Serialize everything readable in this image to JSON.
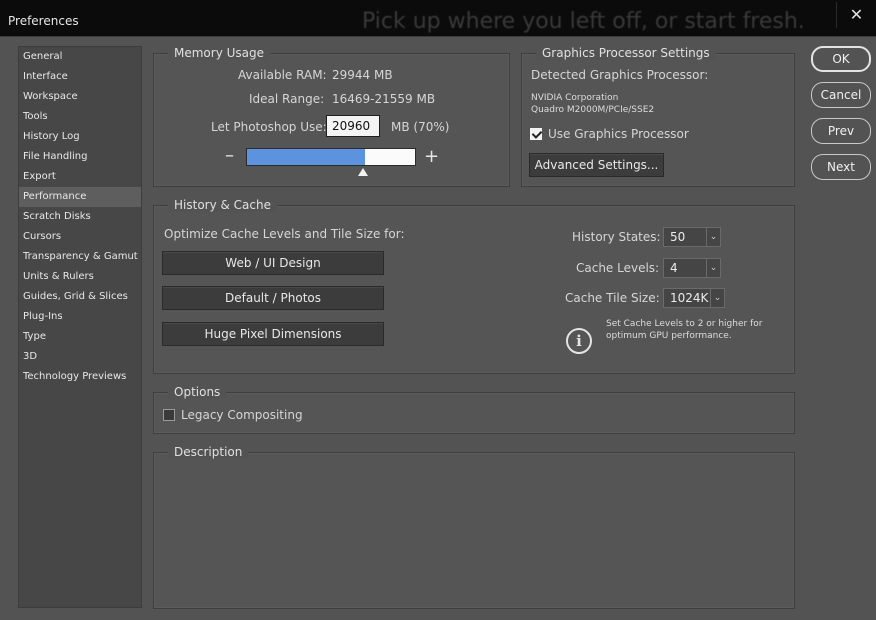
{
  "window": {
    "title": "Preferences",
    "background_text": "Pick up where you left off, or start fresh.",
    "close_glyph": "✕"
  },
  "sidebar": {
    "items": [
      {
        "label": "General"
      },
      {
        "label": "Interface"
      },
      {
        "label": "Workspace"
      },
      {
        "label": "Tools"
      },
      {
        "label": "History Log"
      },
      {
        "label": "File Handling"
      },
      {
        "label": "Export"
      },
      {
        "label": "Performance",
        "selected": true
      },
      {
        "label": "Scratch Disks"
      },
      {
        "label": "Cursors"
      },
      {
        "label": "Transparency & Gamut"
      },
      {
        "label": "Units & Rulers"
      },
      {
        "label": "Guides, Grid & Slices"
      },
      {
        "label": "Plug-Ins"
      },
      {
        "label": "Type"
      },
      {
        "label": "3D"
      },
      {
        "label": "Technology Previews"
      }
    ]
  },
  "memory": {
    "title": "Memory Usage",
    "available_label": "Available RAM:",
    "available_value": "29944 MB",
    "ideal_label": "Ideal Range:",
    "ideal_value": "16469-21559 MB",
    "use_label": "Let Photoshop Use:",
    "use_value": "20960",
    "use_unit": "MB (70%)",
    "slider_fraction": 0.7,
    "minus": "–",
    "plus": "+"
  },
  "gpu": {
    "title": "Graphics Processor Settings",
    "detected_label": "Detected Graphics Processor:",
    "vendor": "NVIDIA Corporation",
    "model": "Quadro M2000M/PCIe/SSE2",
    "use_gpu_label": "Use Graphics Processor",
    "use_gpu_checked": true,
    "advanced_button": "Advanced Settings..."
  },
  "buttons": {
    "ok": "OK",
    "cancel": "Cancel",
    "prev": "Prev",
    "next": "Next"
  },
  "history_cache": {
    "title": "History & Cache",
    "optimize_label": "Optimize Cache Levels and Tile Size for:",
    "web_button": "Web / UI Design",
    "default_button": "Default / Photos",
    "huge_button": "Huge Pixel Dimensions",
    "history_states_label": "History States:",
    "history_states_value": "50",
    "cache_levels_label": "Cache Levels:",
    "cache_levels_value": "4",
    "tile_size_label": "Cache Tile Size:",
    "tile_size_value": "1024K",
    "info_glyph": "i",
    "info_text_1": "Set Cache Levels to 2 or higher for",
    "info_text_2": "optimum GPU performance.",
    "dropdown_glyph": "⌄"
  },
  "options": {
    "title": "Options",
    "legacy_label": "Legacy Compositing",
    "legacy_checked": false
  },
  "description": {
    "title": "Description"
  },
  "colors": {
    "dialog_bg": "#535353",
    "titlebar_bg": "#0b0b0b",
    "slider_fill": "#5b93de",
    "selected_item": "#5e5e5e"
  }
}
